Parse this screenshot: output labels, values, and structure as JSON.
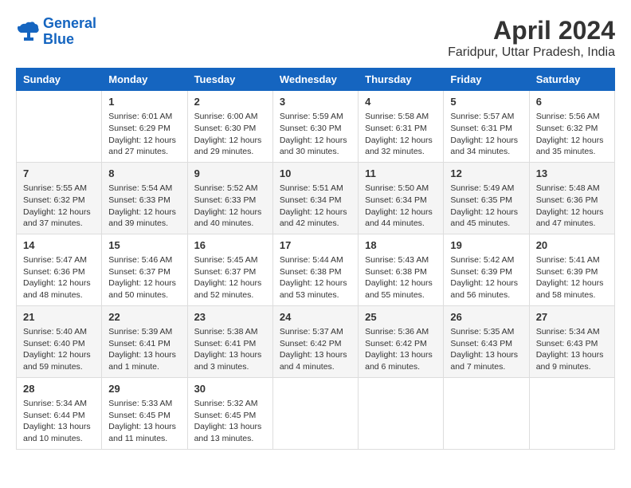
{
  "logo": {
    "line1": "General",
    "line2": "Blue"
  },
  "title": "April 2024",
  "subtitle": "Faridpur, Uttar Pradesh, India",
  "days_header": [
    "Sunday",
    "Monday",
    "Tuesday",
    "Wednesday",
    "Thursday",
    "Friday",
    "Saturday"
  ],
  "weeks": [
    [
      {
        "num": "",
        "content": ""
      },
      {
        "num": "1",
        "content": "Sunrise: 6:01 AM\nSunset: 6:29 PM\nDaylight: 12 hours\nand 27 minutes."
      },
      {
        "num": "2",
        "content": "Sunrise: 6:00 AM\nSunset: 6:30 PM\nDaylight: 12 hours\nand 29 minutes."
      },
      {
        "num": "3",
        "content": "Sunrise: 5:59 AM\nSunset: 6:30 PM\nDaylight: 12 hours\nand 30 minutes."
      },
      {
        "num": "4",
        "content": "Sunrise: 5:58 AM\nSunset: 6:31 PM\nDaylight: 12 hours\nand 32 minutes."
      },
      {
        "num": "5",
        "content": "Sunrise: 5:57 AM\nSunset: 6:31 PM\nDaylight: 12 hours\nand 34 minutes."
      },
      {
        "num": "6",
        "content": "Sunrise: 5:56 AM\nSunset: 6:32 PM\nDaylight: 12 hours\nand 35 minutes."
      }
    ],
    [
      {
        "num": "7",
        "content": "Sunrise: 5:55 AM\nSunset: 6:32 PM\nDaylight: 12 hours\nand 37 minutes."
      },
      {
        "num": "8",
        "content": "Sunrise: 5:54 AM\nSunset: 6:33 PM\nDaylight: 12 hours\nand 39 minutes."
      },
      {
        "num": "9",
        "content": "Sunrise: 5:52 AM\nSunset: 6:33 PM\nDaylight: 12 hours\nand 40 minutes."
      },
      {
        "num": "10",
        "content": "Sunrise: 5:51 AM\nSunset: 6:34 PM\nDaylight: 12 hours\nand 42 minutes."
      },
      {
        "num": "11",
        "content": "Sunrise: 5:50 AM\nSunset: 6:34 PM\nDaylight: 12 hours\nand 44 minutes."
      },
      {
        "num": "12",
        "content": "Sunrise: 5:49 AM\nSunset: 6:35 PM\nDaylight: 12 hours\nand 45 minutes."
      },
      {
        "num": "13",
        "content": "Sunrise: 5:48 AM\nSunset: 6:36 PM\nDaylight: 12 hours\nand 47 minutes."
      }
    ],
    [
      {
        "num": "14",
        "content": "Sunrise: 5:47 AM\nSunset: 6:36 PM\nDaylight: 12 hours\nand 48 minutes."
      },
      {
        "num": "15",
        "content": "Sunrise: 5:46 AM\nSunset: 6:37 PM\nDaylight: 12 hours\nand 50 minutes."
      },
      {
        "num": "16",
        "content": "Sunrise: 5:45 AM\nSunset: 6:37 PM\nDaylight: 12 hours\nand 52 minutes."
      },
      {
        "num": "17",
        "content": "Sunrise: 5:44 AM\nSunset: 6:38 PM\nDaylight: 12 hours\nand 53 minutes."
      },
      {
        "num": "18",
        "content": "Sunrise: 5:43 AM\nSunset: 6:38 PM\nDaylight: 12 hours\nand 55 minutes."
      },
      {
        "num": "19",
        "content": "Sunrise: 5:42 AM\nSunset: 6:39 PM\nDaylight: 12 hours\nand 56 minutes."
      },
      {
        "num": "20",
        "content": "Sunrise: 5:41 AM\nSunset: 6:39 PM\nDaylight: 12 hours\nand 58 minutes."
      }
    ],
    [
      {
        "num": "21",
        "content": "Sunrise: 5:40 AM\nSunset: 6:40 PM\nDaylight: 12 hours\nand 59 minutes."
      },
      {
        "num": "22",
        "content": "Sunrise: 5:39 AM\nSunset: 6:41 PM\nDaylight: 13 hours\nand 1 minute."
      },
      {
        "num": "23",
        "content": "Sunrise: 5:38 AM\nSunset: 6:41 PM\nDaylight: 13 hours\nand 3 minutes."
      },
      {
        "num": "24",
        "content": "Sunrise: 5:37 AM\nSunset: 6:42 PM\nDaylight: 13 hours\nand 4 minutes."
      },
      {
        "num": "25",
        "content": "Sunrise: 5:36 AM\nSunset: 6:42 PM\nDaylight: 13 hours\nand 6 minutes."
      },
      {
        "num": "26",
        "content": "Sunrise: 5:35 AM\nSunset: 6:43 PM\nDaylight: 13 hours\nand 7 minutes."
      },
      {
        "num": "27",
        "content": "Sunrise: 5:34 AM\nSunset: 6:43 PM\nDaylight: 13 hours\nand 9 minutes."
      }
    ],
    [
      {
        "num": "28",
        "content": "Sunrise: 5:34 AM\nSunset: 6:44 PM\nDaylight: 13 hours\nand 10 minutes."
      },
      {
        "num": "29",
        "content": "Sunrise: 5:33 AM\nSunset: 6:45 PM\nDaylight: 13 hours\nand 11 minutes."
      },
      {
        "num": "30",
        "content": "Sunrise: 5:32 AM\nSunset: 6:45 PM\nDaylight: 13 hours\nand 13 minutes."
      },
      {
        "num": "",
        "content": ""
      },
      {
        "num": "",
        "content": ""
      },
      {
        "num": "",
        "content": ""
      },
      {
        "num": "",
        "content": ""
      }
    ]
  ]
}
